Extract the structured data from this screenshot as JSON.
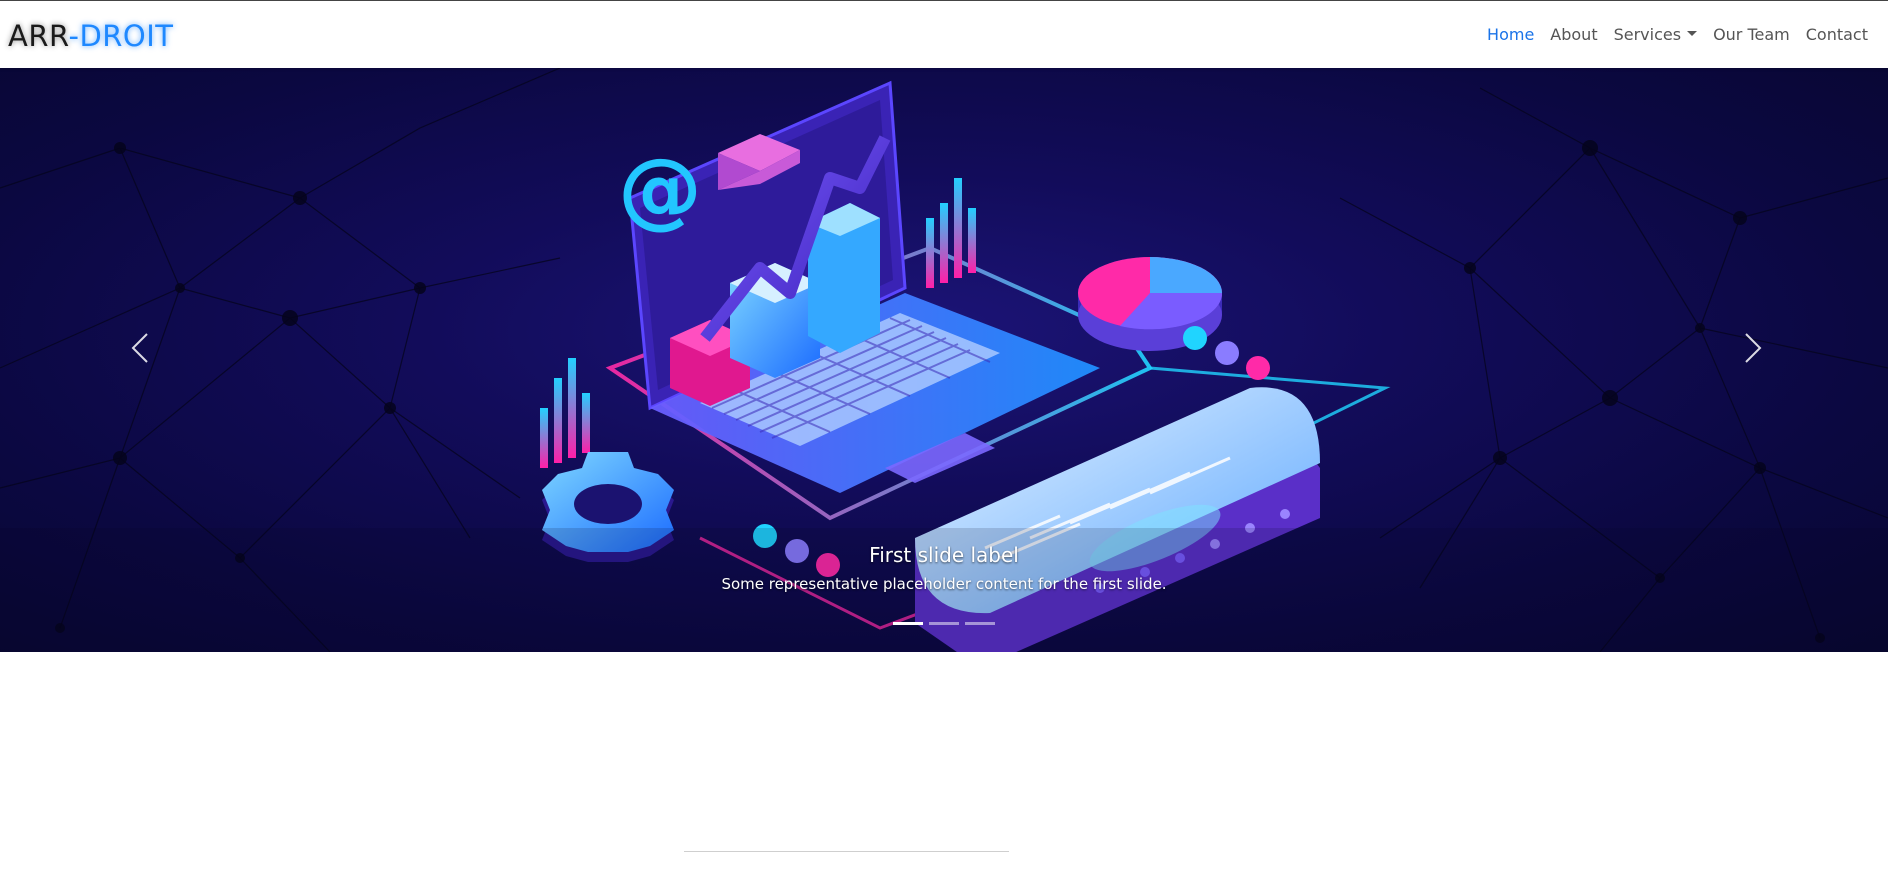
{
  "brand": {
    "part1": "ARR",
    "part2": "-",
    "part3": "DROIT"
  },
  "nav": {
    "items": [
      {
        "label": "Home",
        "active": true
      },
      {
        "label": "About"
      },
      {
        "label": "Services",
        "dropdown": true
      },
      {
        "label": "Our Team"
      },
      {
        "label": "Contact"
      }
    ]
  },
  "carousel": {
    "slide_title": "First slide label",
    "slide_text": "Some representative placeholder content for the first slide.",
    "indicator_count": 3,
    "active_index": 0,
    "prev_icon": "chevron-left-icon",
    "next_icon": "chevron-right-icon",
    "image_icons": [
      "at-icon",
      "envelope-icon",
      "laptop-icon",
      "bar-chart-icon",
      "pie-chart-icon",
      "gear-icon",
      "tablet-icon"
    ]
  },
  "colors": {
    "brand_accent": "#1e88ff",
    "nav_active": "#1a73e8",
    "nav_text": "#555555",
    "banner_bg": "#120c5a"
  }
}
